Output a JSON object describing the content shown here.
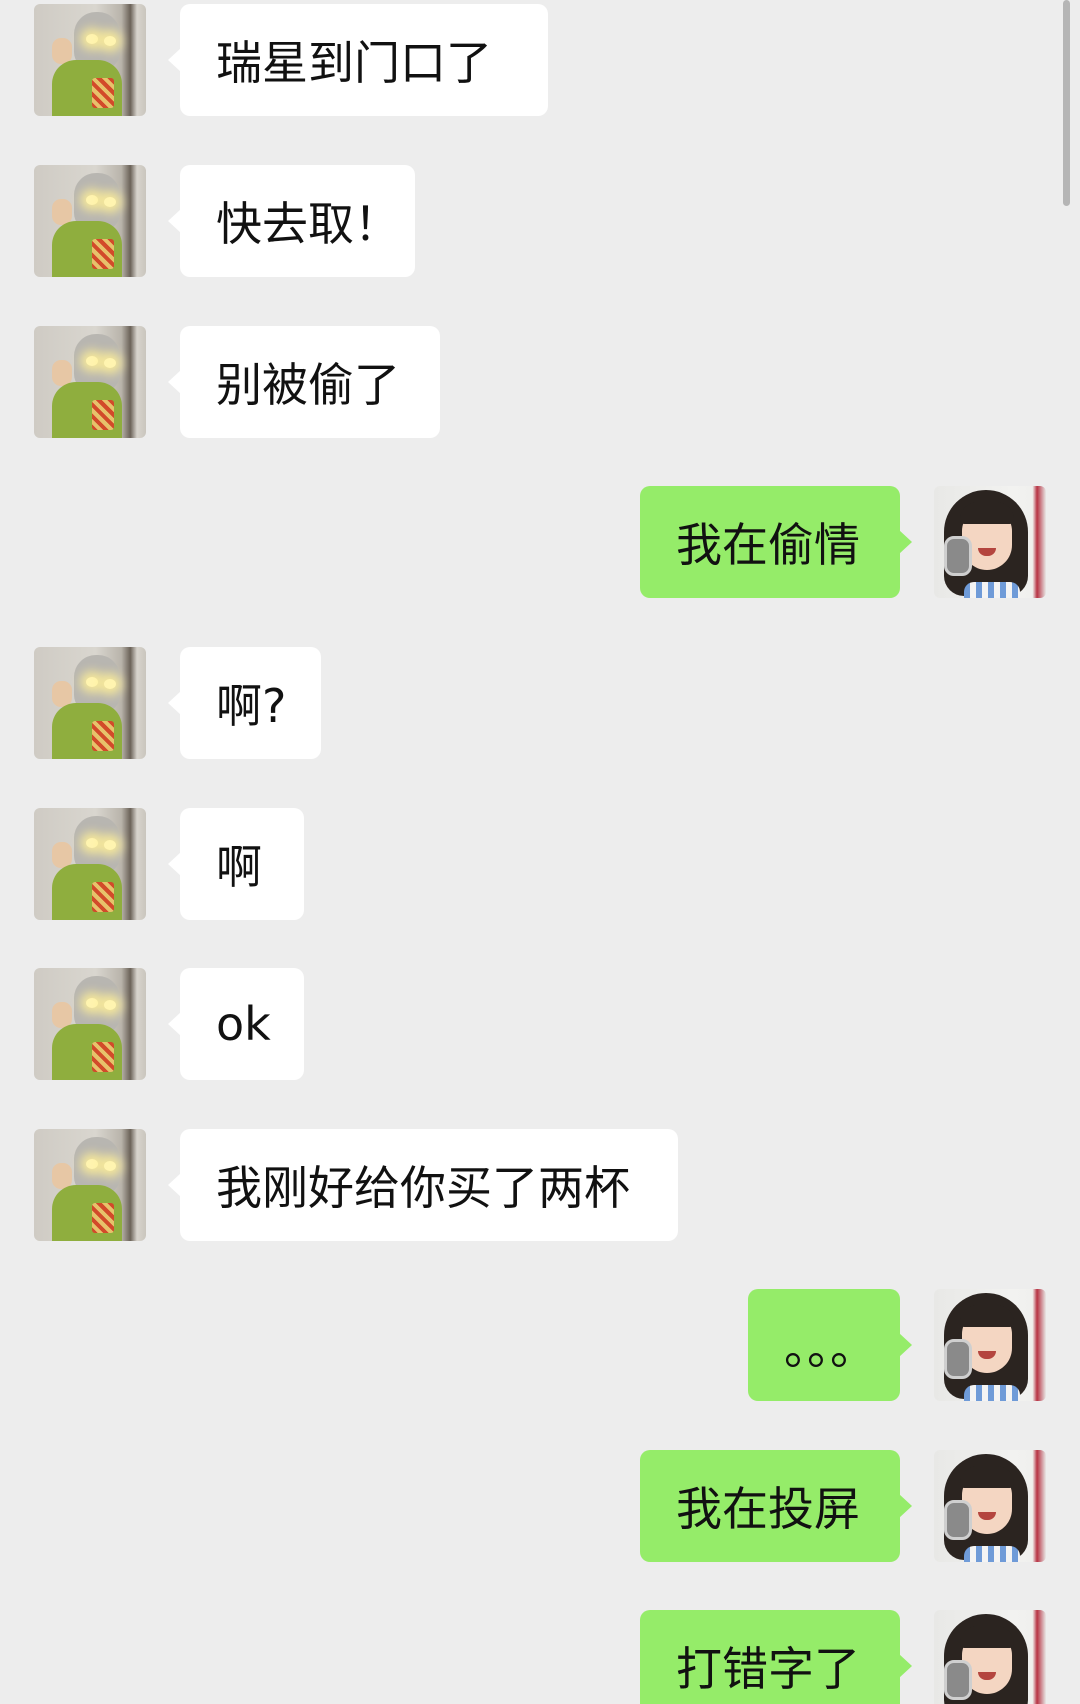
{
  "conversation": {
    "messages": [
      {
        "sender": "friend",
        "text": "瑞星到门口了"
      },
      {
        "sender": "friend",
        "text": "快去取！"
      },
      {
        "sender": "friend",
        "text": "别被偷了"
      },
      {
        "sender": "me",
        "text": "我在偷情"
      },
      {
        "sender": "friend",
        "text": "啊?"
      },
      {
        "sender": "friend",
        "text": "啊"
      },
      {
        "sender": "friend",
        "text": "ok"
      },
      {
        "sender": "friend",
        "text": "我刚好给你买了两杯"
      },
      {
        "sender": "me",
        "text": "。。。"
      },
      {
        "sender": "me",
        "text": "我在投屏"
      },
      {
        "sender": "me",
        "text": "打错字了"
      }
    ]
  },
  "colors": {
    "background": "#ededed",
    "friend_bubble": "#ffffff",
    "my_bubble": "#95ec69",
    "text": "#111111"
  },
  "icons": {
    "friend_avatar": "friend-avatar-masked-figure",
    "my_avatar": "my-avatar-girl-with-headphones"
  }
}
